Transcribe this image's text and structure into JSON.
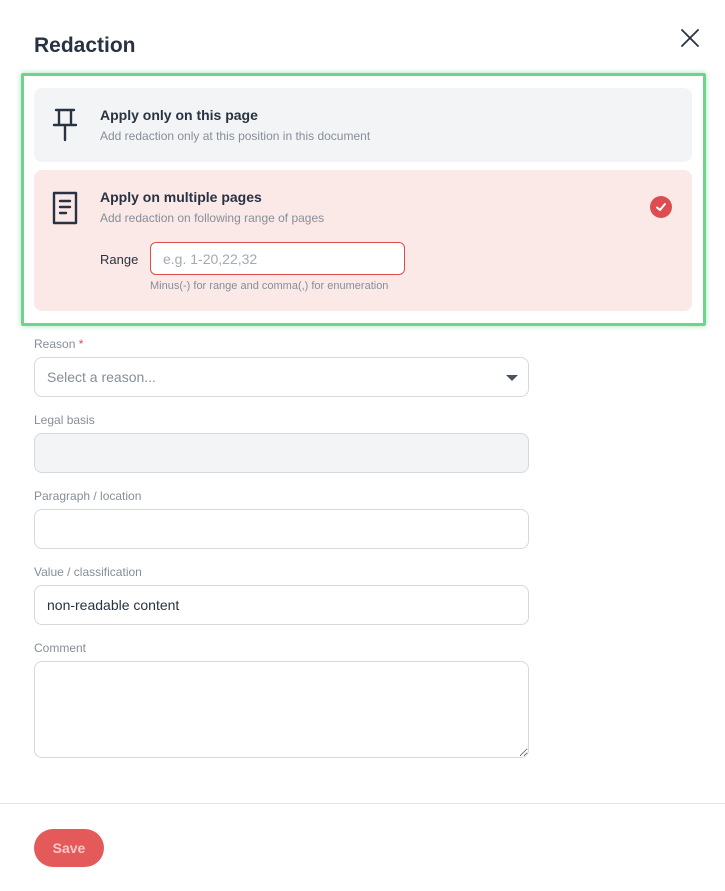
{
  "dialog": {
    "title": "Redaction"
  },
  "options": {
    "page": {
      "title": "Apply only on this page",
      "description": "Add redaction only at this position in this document",
      "icon": "pin-icon"
    },
    "multiple": {
      "title": "Apply on multiple pages",
      "description": "Add redaction on following range of pages",
      "icon": "document-icon",
      "selected": true,
      "range_label": "Range",
      "range_placeholder": "e.g. 1-20,22,32",
      "range_value": "",
      "range_hint": "Minus(-) for range and comma(,) for enumeration"
    }
  },
  "form": {
    "reason": {
      "label": "Reason",
      "required_mark": "*",
      "placeholder": "Select a reason..."
    },
    "legal_basis": {
      "label": "Legal basis",
      "value": ""
    },
    "paragraph": {
      "label": "Paragraph / location",
      "value": ""
    },
    "value_classification": {
      "label": "Value / classification",
      "value": "non-readable content"
    },
    "comment": {
      "label": "Comment",
      "value": ""
    }
  },
  "footer": {
    "save_label": "Save"
  },
  "colors": {
    "accent": "#dd4d50",
    "selected_bg": "#fbe9e8",
    "option_bg": "#f3f4f6",
    "highlight": "#6fd48b"
  }
}
